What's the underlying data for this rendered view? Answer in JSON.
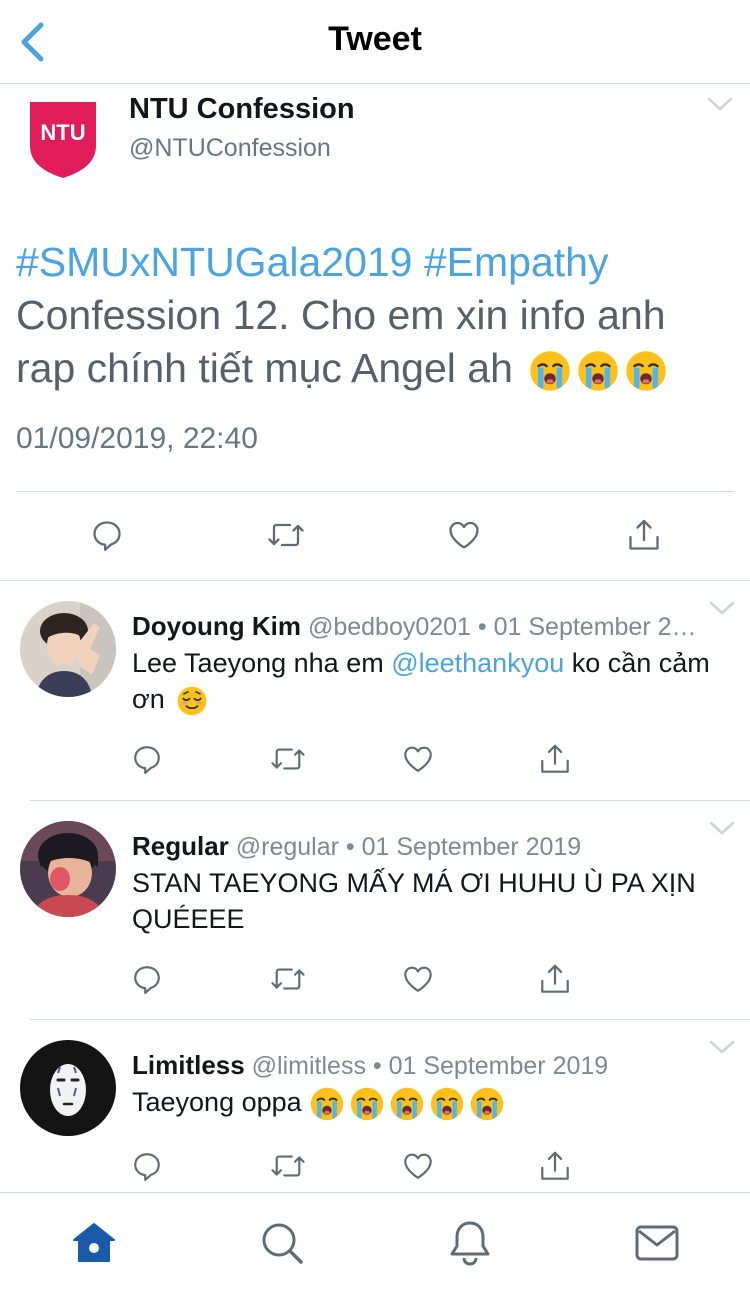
{
  "nav": {
    "title": "Tweet"
  },
  "tweet": {
    "author_name": "NTU Confession",
    "author_handle": "@NTUConfession",
    "logo_text": "NTU",
    "hashtags": "#SMUxNTUGala2019 #Empathy",
    "body": "Confession 12. Cho em xin info anh rap chính tiết mục Angel ah",
    "timestamp": "01/09/2019, 22:40"
  },
  "replies": [
    {
      "name": "Doyoung Kim",
      "meta": "@bedboy0201 • 01 September 2…",
      "text_before": "Lee Taeyong nha em ",
      "mention": "@leethankyou",
      "text_after": " ko cần cảm ơn"
    },
    {
      "name": "Regular",
      "meta": "@regular • 01 September 2019",
      "text": "STAN TAEYONG MẤY MÁ ƠI HUHU Ù PA XỊN QUÉEEE"
    },
    {
      "name": "Limitless",
      "meta": "@limitless • 01 September 2019",
      "text": "Taeyong oppa"
    }
  ],
  "colors": {
    "accent": "#4ba4e2",
    "tabbar_active": "#1b5aa8",
    "icon_gray": "#5f6b75",
    "logo_red": "#e01d5a"
  },
  "icons": {
    "back": "chevron-left-icon",
    "caret": "chevron-down-icon",
    "reply": "reply-icon",
    "retweet": "retweet-icon",
    "like": "heart-icon",
    "share": "share-icon",
    "tabs": [
      "home-icon",
      "search-icon",
      "bell-icon",
      "mail-icon"
    ]
  }
}
